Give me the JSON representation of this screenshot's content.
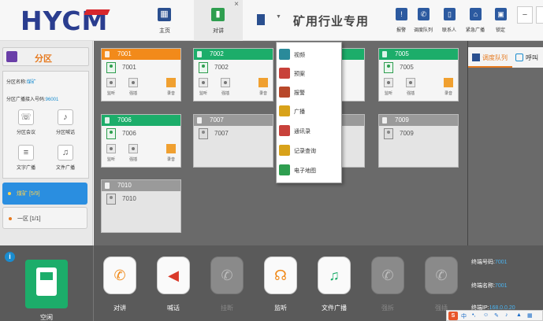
{
  "header": {
    "logo_text": "HYCM",
    "tabs": [
      {
        "label": "主页",
        "icon": "home-grid-icon"
      },
      {
        "label": "对讲",
        "icon": "intercom-icon"
      }
    ],
    "tab_close": "×",
    "dropdown": "▼",
    "system_title": "矿用行业专用",
    "tools": [
      {
        "label": "报警",
        "icon": "alarm-icon"
      },
      {
        "label": "调度队列",
        "icon": "phone-queue-icon"
      },
      {
        "label": "联系人",
        "icon": "contacts-icon"
      },
      {
        "label": "紧急广播",
        "icon": "emergency-broadcast-icon"
      },
      {
        "label": "锁定",
        "icon": "lock-icon"
      }
    ],
    "minimize": "−",
    "close": "×"
  },
  "left_panel": {
    "title": "分区",
    "zone_name_label": "分区名称:",
    "zone_name_value": "煤矿",
    "broadcast_label": "分区广播接入号码:",
    "broadcast_value": "96001",
    "actions": [
      {
        "label": "分区会议",
        "icon": "walkie-talkie-icon"
      },
      {
        "label": "分区喊话",
        "icon": "microphone-icon"
      },
      {
        "label": "文字广播",
        "icon": "text-document-icon"
      },
      {
        "label": "文件广播",
        "icon": "music-file-icon"
      }
    ],
    "zones": [
      {
        "label": "煤矿 [5/9]",
        "selected": true
      },
      {
        "label": "一区 [1/1]",
        "selected": false
      }
    ]
  },
  "terminals": [
    {
      "id": "7001",
      "name": "7001",
      "state": "busy",
      "header_color": "#f28a1a"
    },
    {
      "id": "7002",
      "name": "7002",
      "state": "online",
      "header_color": "#1cad6a"
    },
    {
      "id": "7005",
      "name": "7005",
      "state": "online",
      "header_color": "#1cad6a"
    },
    {
      "id": "7006",
      "name": "7006",
      "state": "online",
      "header_color": "#1cad6a"
    },
    {
      "id": "7007",
      "name": "7007",
      "state": "offline",
      "header_color": "#9a9a9a"
    },
    {
      "id": "7009",
      "name": "7009",
      "state": "offline",
      "header_color": "#9a9a9a"
    },
    {
      "id": "7010",
      "name": "7010",
      "state": "offline",
      "header_color": "#9a9a9a"
    }
  ],
  "card_buttons": {
    "left": "监听",
    "mid": "强插",
    "rec": "录音"
  },
  "context_menu": [
    {
      "label": "视频",
      "icon": "video-icon",
      "color": "#2a8a9a"
    },
    {
      "label": "预案",
      "icon": "plan-icon",
      "color": "#c8413a"
    },
    {
      "label": "报警",
      "icon": "alarm-icon",
      "color": "#b8482a"
    },
    {
      "label": "广播",
      "icon": "broadcast-icon",
      "color": "#d8a21a"
    },
    {
      "label": "通讯录",
      "icon": "address-book-icon",
      "color": "#c8413a"
    },
    {
      "label": "记录查询",
      "icon": "search-record-icon",
      "color": "#d8a21a"
    },
    {
      "label": "电子地图",
      "icon": "map-icon",
      "color": "#2e9e4f"
    }
  ],
  "right_panel": {
    "tabs": [
      {
        "label": "调度队列",
        "icon": "queue-icon"
      },
      {
        "label": "呼叫",
        "icon": "call-icon"
      }
    ]
  },
  "bottom": {
    "status": "空闲",
    "info_icon": "i",
    "actions": [
      {
        "label": "对讲",
        "icon": "handset-icon",
        "glyph": "✆",
        "enabled": true,
        "color": "#f08a1a"
      },
      {
        "label": "喊话",
        "icon": "megaphone-icon",
        "glyph": "◀",
        "enabled": true,
        "color": "#d93a2a"
      },
      {
        "label": "挂断",
        "icon": "hangup-icon",
        "glyph": "✆",
        "enabled": false,
        "color": "#bbbbbb"
      },
      {
        "label": "监听",
        "icon": "headset-icon",
        "glyph": "☊",
        "enabled": true,
        "color": "#f08a1a"
      },
      {
        "label": "文件广播",
        "icon": "music-file-icon",
        "glyph": "♫",
        "enabled": true,
        "color": "#1cad6a"
      },
      {
        "label": "强拆",
        "icon": "force-disconnect-icon",
        "glyph": "✆",
        "enabled": false,
        "color": "#bbbbbb"
      },
      {
        "label": "强插",
        "icon": "force-insert-icon",
        "glyph": "✆",
        "enabled": false,
        "color": "#bbbbbb"
      }
    ],
    "terminal_number_label": "终端号码:",
    "terminal_number_value": "7001",
    "terminal_name_label": "终端名称:",
    "terminal_name_value": "7001",
    "terminal_ip_label": "终端IP:",
    "terminal_ip_value": "168.0.0.20"
  },
  "ime": {
    "logo": "S",
    "lang": "中"
  }
}
